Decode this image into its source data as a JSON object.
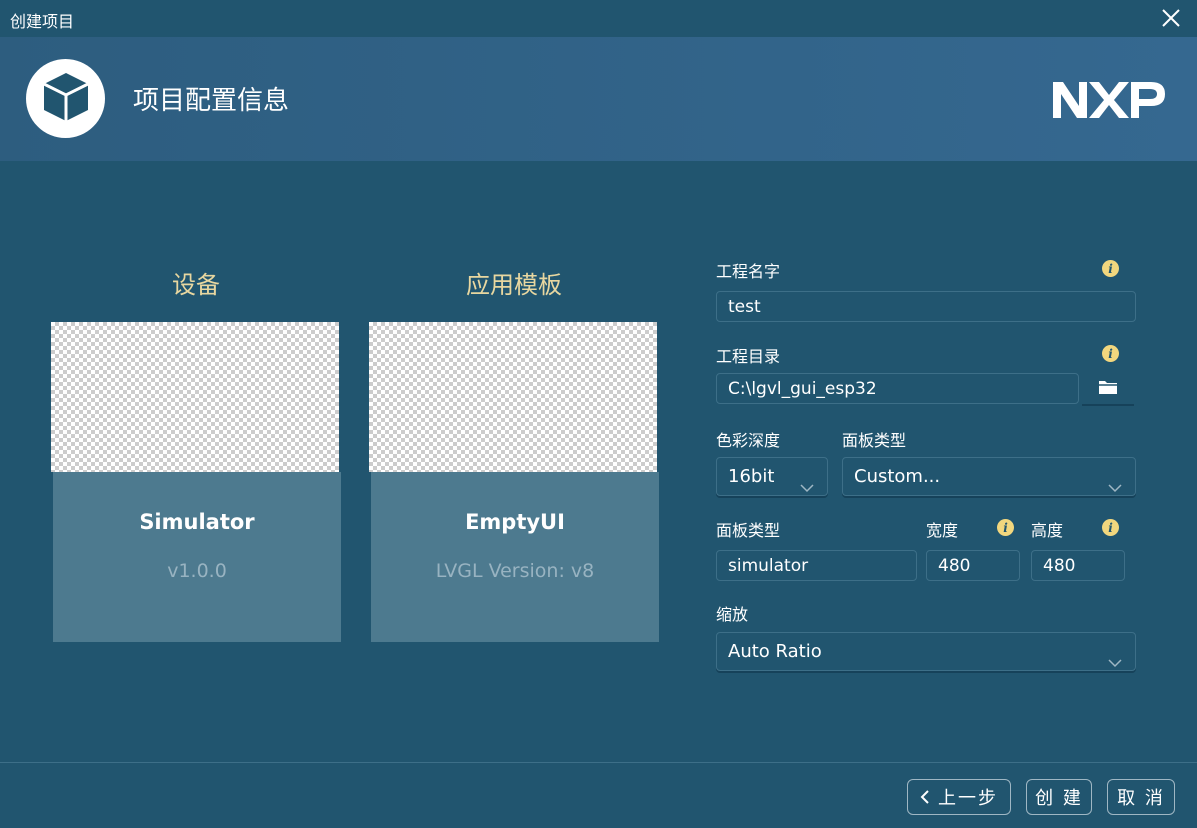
{
  "window": {
    "title": "创建项目",
    "close_icon": "close-icon"
  },
  "header": {
    "title": "项目配置信息",
    "logo_icon": "cube-icon",
    "brand": "NXP"
  },
  "device": {
    "section_label": "设备",
    "name": "Simulator",
    "version": "v1.0.0"
  },
  "template": {
    "section_label": "应用模板",
    "name": "EmptyUI",
    "version": "LVGL Version: v8"
  },
  "form": {
    "project_name": {
      "label": "工程名字",
      "value": "test"
    },
    "project_dir": {
      "label": "工程目录",
      "value": "C:\\lgvl_gui_esp32",
      "browse_icon": "folder-icon"
    },
    "color_depth": {
      "label": "色彩深度",
      "value": "16bit"
    },
    "panel_type_select": {
      "label": "面板类型",
      "value": "Custom..."
    },
    "panel_type_input": {
      "label": "面板类型",
      "value": "simulator"
    },
    "width": {
      "label": "宽度",
      "value": "480"
    },
    "height": {
      "label": "高度",
      "value": "480"
    },
    "scale": {
      "label": "缩放",
      "value": "Auto Ratio"
    }
  },
  "footer": {
    "back_label": "上一步",
    "create_label": "创 建",
    "cancel_label": "取 消"
  },
  "colors": {
    "background": "#21556f",
    "header": "#356890",
    "section_label": "#e8d7a0",
    "info_icon": "#f2d77e",
    "card_info": "#4d7a8f"
  }
}
